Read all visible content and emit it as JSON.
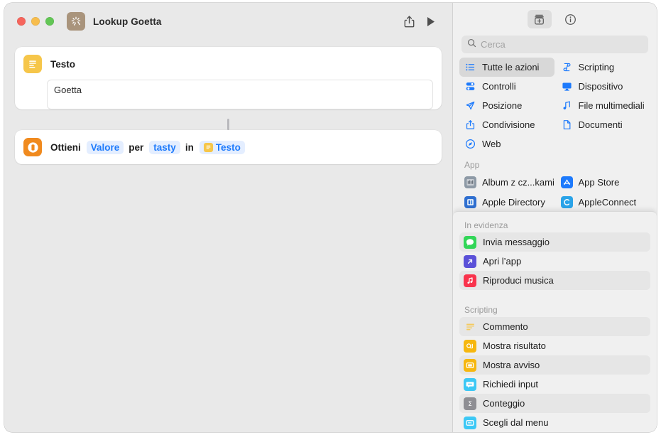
{
  "window": {
    "doc_title": "Lookup Goetta",
    "app_icon": "shortcuts-icon",
    "traffic_lights": [
      "close",
      "minimize",
      "zoom"
    ],
    "share_button": "share-icon",
    "run_button": "play-icon"
  },
  "editor": {
    "actions": [
      {
        "title": "Testo",
        "icon": "text-action-icon",
        "icon_color": "#f6c64a",
        "field_value": "Goetta"
      },
      {
        "icon": "get-dictionary-value-icon",
        "icon_color": "#f08a1e",
        "words": {
          "w1": "Ottieni",
          "t1": "Valore",
          "w2": "per",
          "t2": "tasty",
          "w3": "in",
          "t3": "Testo"
        }
      }
    ]
  },
  "sidebar": {
    "toolbar": {
      "library_button": "action-library-icon",
      "info_button": "info-circle-icon"
    },
    "search": {
      "placeholder": "Cerca",
      "value": "",
      "icon": "search-icon"
    },
    "categories": [
      {
        "label": "Tutte le azioni",
        "icon": "list-bullet-icon",
        "selected": true
      },
      {
        "label": "Scripting",
        "icon": "scroll-icon",
        "selected": false
      },
      {
        "label": "Controlli",
        "icon": "toggles-icon",
        "selected": false
      },
      {
        "label": "Dispositivo",
        "icon": "display-icon",
        "selected": false
      },
      {
        "label": "Posizione",
        "icon": "paperplane-icon",
        "selected": false
      },
      {
        "label": "File multimediali",
        "icon": "music-note-icon",
        "selected": false
      },
      {
        "label": "Condivisione",
        "icon": "share-icon",
        "selected": false
      },
      {
        "label": "Documenti",
        "icon": "document-icon",
        "selected": false
      },
      {
        "label": "Web",
        "icon": "safari-icon",
        "selected": false
      }
    ],
    "app_section": {
      "label": "App",
      "items": [
        {
          "label": "Album z cz...kami",
          "icon": "photos-app-icon",
          "color": "#8e9aa6"
        },
        {
          "label": "App Store",
          "icon": "app-store-icon",
          "color": "#1d7afc"
        },
        {
          "label": "Apple Directory",
          "icon": "apple-directory-icon",
          "color": "#2f6fd0"
        },
        {
          "label": "AppleConnect",
          "icon": "appleconnect-icon",
          "color": "#2aa3e8"
        }
      ]
    }
  },
  "overlay": {
    "featured": {
      "label": "In evidenza",
      "items": [
        {
          "label": "Invia messaggio",
          "icon": "messages-icon",
          "color": "#32d658",
          "alt": true
        },
        {
          "label": "Apri l’app",
          "icon": "open-app-icon",
          "color": "#5b51d8",
          "alt": false
        },
        {
          "label": "Riproduci musica",
          "icon": "music-app-icon",
          "color": "#f9334c",
          "alt": true
        }
      ]
    },
    "scripting": {
      "label": "Scripting",
      "items": [
        {
          "label": "Commento",
          "icon": "comment-icon",
          "color": "#f6c64a",
          "alt": true
        },
        {
          "label": "Mostra risultato",
          "icon": "show-result-icon",
          "color": "#f6b70f",
          "alt": false
        },
        {
          "label": "Mostra avviso",
          "icon": "show-alert-icon",
          "color": "#f6b70f",
          "alt": true
        },
        {
          "label": "Richiedi input",
          "icon": "ask-input-icon",
          "color": "#3cc8f5",
          "alt": false
        },
        {
          "label": "Conteggio",
          "icon": "count-icon",
          "color": "#8e8e93",
          "alt": true
        },
        {
          "label": "Scegli dal menu",
          "icon": "choose-menu-icon",
          "color": "#3cc8f5",
          "alt": false
        }
      ]
    }
  },
  "colors": {
    "accent_blue": "#1d7afc",
    "yellow": "#f6c64a",
    "orange": "#f08a1e",
    "window_bg": "#e9e9e9",
    "sidebar_bg": "#f0f0f0"
  }
}
